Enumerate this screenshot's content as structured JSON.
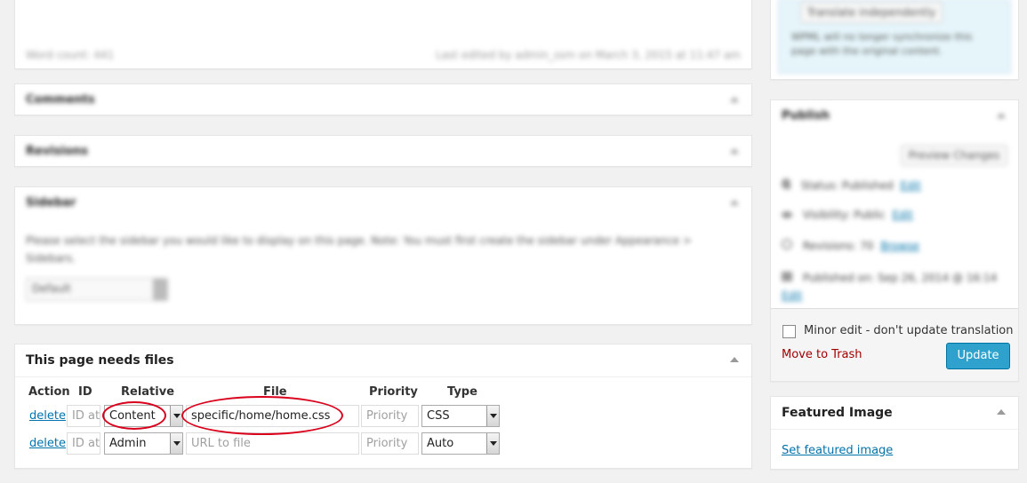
{
  "editor_footer": {
    "word_count": "Word count: 441",
    "last_edited": "Last edited by admin_ssm on March 3, 2015 at 11:47 am"
  },
  "boxes": {
    "comments_title": "Comments",
    "revisions_title": "Revisions",
    "sidebar": {
      "title": "Sidebar",
      "description": "Please select the sidebar you would like to display on this page. Note: You must first create the sidebar under Appearance > Sidebars.",
      "select_value": "Default"
    }
  },
  "files_box": {
    "title": "This page needs files",
    "headers": [
      "Action",
      "ID",
      "Relative",
      "File",
      "Priority",
      "Type"
    ],
    "rows": [
      {
        "action": "delete",
        "id_placeholder": "ID att",
        "relative": "Content",
        "file": "specific/home/home.css",
        "file_placeholder": "",
        "priority_placeholder": "Priority",
        "type": "CSS"
      },
      {
        "action": "delete",
        "id_placeholder": "ID att",
        "relative": "Admin",
        "file": "",
        "file_placeholder": "URL to file",
        "priority_placeholder": "Priority",
        "type": "Auto"
      }
    ]
  },
  "translation_box": {
    "button": "Translate independently",
    "note": "WPML will no longer synchronize this page with the original content."
  },
  "publish_box": {
    "title": "Publish",
    "preview_button": "Preview Changes",
    "status": "Status: Published",
    "visibility": "Visibility: Public",
    "revisions": "Revisions: 70",
    "revisions_link": "Browse",
    "published_on": "Published on: Sep 26, 2014 @ 16:14",
    "edit_link": "Edit",
    "minor_edit": "Minor edit - don't update translation",
    "move_to_trash": "Move to Trash",
    "update_button": "Update"
  },
  "featured_image": {
    "title": "Featured Image",
    "link": "Set featured image"
  },
  "colors": {
    "accent": "#2ea2cc",
    "trash": "#a00000",
    "annotation": "#d9001b",
    "link": "#0073aa"
  }
}
